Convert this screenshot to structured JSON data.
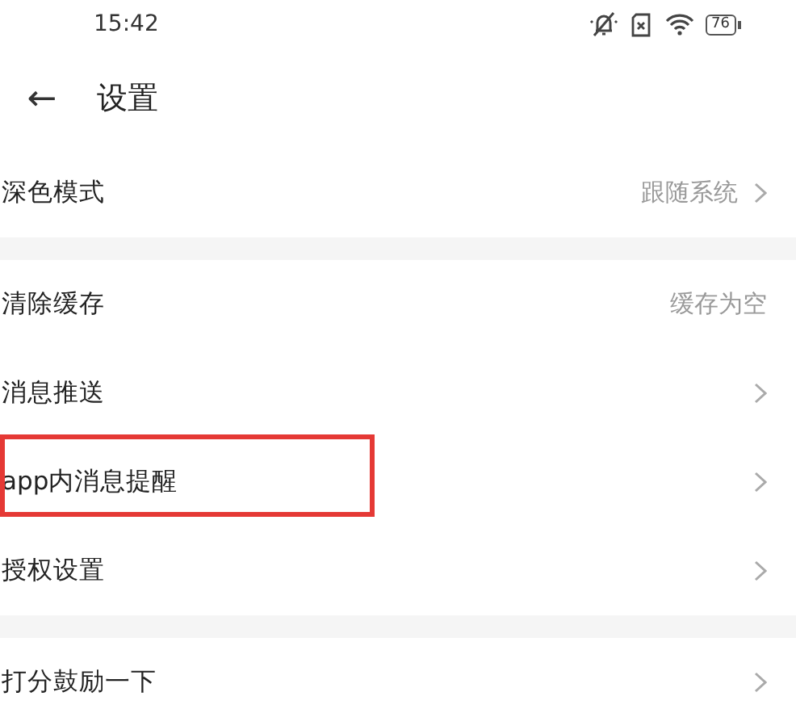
{
  "status_bar": {
    "time": "15:42",
    "battery": "76"
  },
  "header": {
    "back": "←",
    "title": "设置"
  },
  "groups": [
    {
      "items": [
        {
          "label": "深色模式",
          "value": "跟随系统",
          "chevron": true,
          "highlighted": false
        }
      ]
    },
    {
      "items": [
        {
          "label": "清除缓存",
          "value": "缓存为空",
          "chevron": false,
          "highlighted": false
        },
        {
          "label": "消息推送",
          "chevron": true,
          "highlighted": false
        },
        {
          "label": "app内消息提醒",
          "chevron": true,
          "highlighted": true
        },
        {
          "label": "授权设置",
          "chevron": true,
          "highlighted": false
        }
      ]
    },
    {
      "items": [
        {
          "label": "打分鼓励一下",
          "chevron": true,
          "highlighted": false
        }
      ]
    }
  ]
}
